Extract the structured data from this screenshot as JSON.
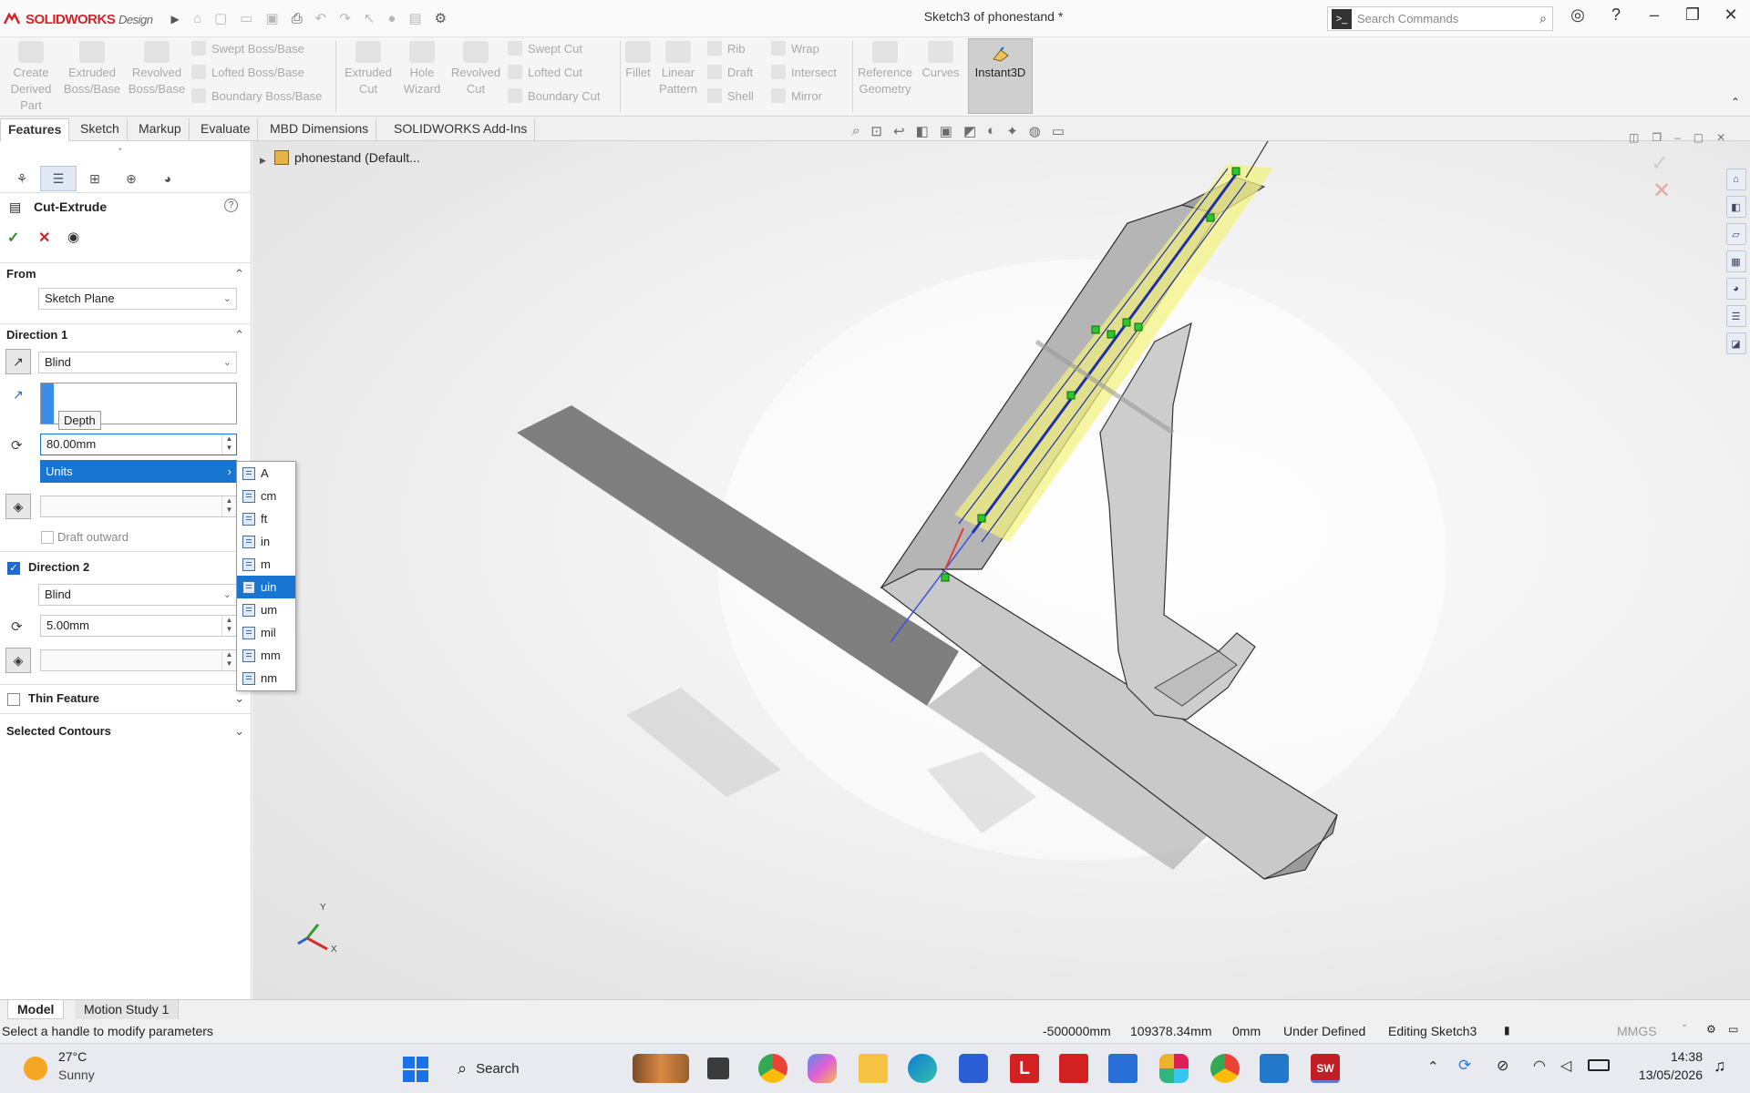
{
  "titlebar": {
    "app_brand": "SOLIDWORKS",
    "app_suffix": "Design",
    "window_title": "Sketch3 of phonestand *",
    "search_placeholder": "Search Commands"
  },
  "ribbon": {
    "large_buttons": [
      {
        "l1": "Create",
        "l2": "Derived",
        "l3": "Part"
      },
      {
        "l1": "Extruded",
        "l2": "Boss/Base",
        "l3": ""
      },
      {
        "l1": "Revolved",
        "l2": "Boss/Base",
        "l3": ""
      },
      {
        "l1": "Extruded",
        "l2": "Cut",
        "l3": ""
      },
      {
        "l1": "Hole",
        "l2": "Wizard",
        "l3": ""
      },
      {
        "l1": "Revolved",
        "l2": "Cut",
        "l3": ""
      },
      {
        "l1": "Fillet",
        "l2": "",
        "l3": ""
      },
      {
        "l1": "Linear",
        "l2": "Pattern",
        "l3": ""
      },
      {
        "l1": "Reference",
        "l2": "Geometry",
        "l3": ""
      },
      {
        "l1": "Curves",
        "l2": "",
        "l3": ""
      }
    ],
    "small_buttons": [
      "Swept Boss/Base",
      "Lofted Boss/Base",
      "Boundary Boss/Base",
      "Swept Cut",
      "Lofted Cut",
      "Boundary Cut",
      "Rib",
      "Draft",
      "Shell",
      "Wrap",
      "Intersect",
      "Mirror"
    ],
    "instant3d": "Instant3D"
  },
  "tabs": [
    "Features",
    "Sketch",
    "Markup",
    "Evaluate",
    "MBD Dimensions",
    "SOLIDWORKS Add-Ins"
  ],
  "propertymanager": {
    "title": "Cut-Extrude",
    "from_label": "From",
    "from_value": "Sketch Plane",
    "dir1_label": "Direction 1",
    "dir1_type": "Blind",
    "tooltip": "Depth",
    "dir1_depth": "80.00mm",
    "units_label": "Units",
    "draft_outward": "Draft outward",
    "dir2_label": "Direction 2",
    "dir2_type": "Blind",
    "dir2_depth": "5.00mm",
    "thin_feature": "Thin Feature",
    "selected_contours": "Selected Contours"
  },
  "units_menu": {
    "items": [
      "A",
      "cm",
      "ft",
      "in",
      "m",
      "uin",
      "um",
      "mil",
      "mm",
      "nm"
    ],
    "selected": "uin"
  },
  "tree": {
    "root": "phonestand (Default..."
  },
  "triad": {
    "y": "Y",
    "x": "X"
  },
  "bottom_tabs": [
    "Model",
    "Motion Study 1"
  ],
  "status": {
    "message": "Select a handle to modify parameters",
    "x": "-500000mm",
    "y": "109378.34mm",
    "z": "0mm",
    "state": "Under Defined",
    "editing": "Editing Sketch3",
    "units": "MMGS"
  },
  "taskbar": {
    "weather_temp": "27°C",
    "weather_desc": "Sunny",
    "search": "Search",
    "time": "14:38",
    "date": "13/05/2026"
  },
  "colors": {
    "accent": "#1975d2",
    "brand": "#d3242b",
    "highlight": "#f3f27a"
  }
}
